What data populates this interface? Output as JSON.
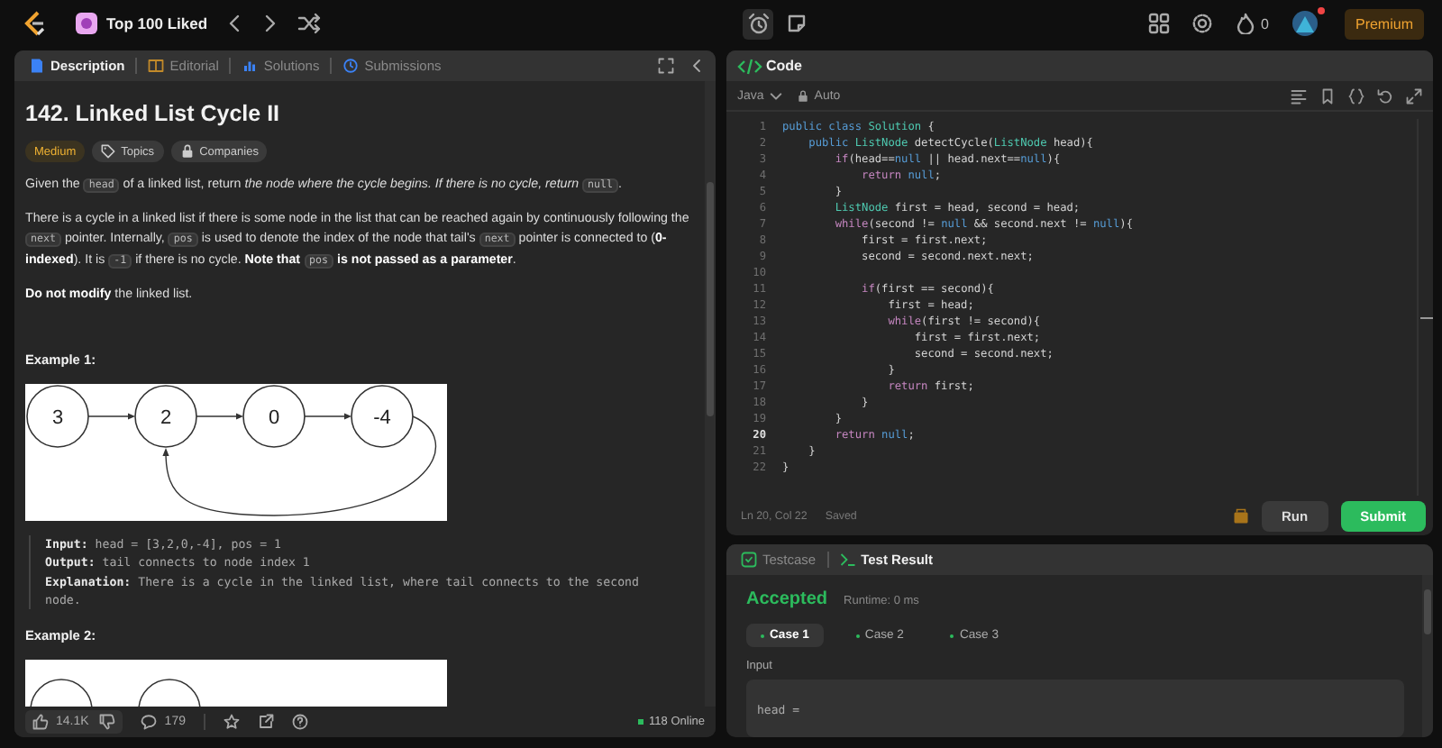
{
  "top_bar": {
    "list_title": "Top 100 Liked",
    "fire_count": "0",
    "premium": "Premium",
    "notification": true
  },
  "description_panel": {
    "tabs": [
      {
        "label": "Description",
        "selected": true
      },
      {
        "label": "Editorial",
        "selected": false
      },
      {
        "label": "Solutions",
        "selected": false
      },
      {
        "label": "Submissions",
        "selected": false
      }
    ],
    "title": "142. Linked List Cycle II",
    "tags": [
      {
        "label": "Medium",
        "kind": "difficulty"
      },
      {
        "label": "Topics",
        "kind": "topics"
      },
      {
        "label": "Companies",
        "kind": "companies"
      }
    ],
    "paragraphs": [
      [
        {
          "kind": "text",
          "text": "Given the "
        },
        {
          "kind": "code",
          "text": "head"
        },
        {
          "kind": "text",
          "text": " of a linked list, return *the node where the cycle begins. If there is no cycle, return* "
        },
        {
          "kind": "code",
          "text": "null"
        },
        {
          "kind": "text",
          "text": "."
        }
      ],
      [
        {
          "kind": "text",
          "text": "There is a cycle in a linked list if there is some node in the list that can be reached again by continuously following the "
        },
        {
          "kind": "code",
          "text": "next"
        },
        {
          "kind": "text",
          "text": " pointer. Internally, "
        },
        {
          "kind": "code",
          "text": "pos"
        },
        {
          "kind": "text",
          "text": " is used to denote the index of the node that tail's "
        },
        {
          "kind": "code",
          "text": "next"
        },
        {
          "kind": "text",
          "text": " pointer is connected to (**0-indexed**). It is "
        },
        {
          "kind": "code",
          "text": "-1"
        },
        {
          "kind": "text",
          "text": " if there is no cycle. **Note that** "
        },
        {
          "kind": "code",
          "text": "pos"
        },
        {
          "kind": "text",
          "text": " **is not passed as a parameter**."
        }
      ],
      [
        {
          "kind": "text",
          "text": "**Do not modify** the linked list."
        }
      ]
    ],
    "examples": [
      {
        "heading": "Example 1:",
        "nodes": [
          "3",
          "2",
          "0",
          "-4"
        ],
        "lines": [
          "**Input:** head = [3,2,0,-4], pos = 1",
          "**Output:** tail connects to node index 1",
          "**Explanation:** There is a cycle in the linked list, where tail connects to the second node."
        ]
      },
      {
        "heading": "Example 2:"
      }
    ],
    "footer": {
      "likes": "14.1K",
      "comments": "179",
      "online": "118 Online"
    }
  },
  "code_panel": {
    "title": "Code",
    "language": "Java",
    "mode": "Auto",
    "lines": [
      {
        "number": "1",
        "tokens": [
          {
            "text": "public class ",
            "kind": "kw"
          },
          {
            "text": "Solution",
            "kind": "ty"
          },
          {
            "text": " {",
            "kind": "p"
          }
        ]
      },
      {
        "number": "2",
        "tokens": [
          {
            "text": "    public ",
            "kind": "kw"
          },
          {
            "text": "ListNode",
            "kind": "ty"
          },
          {
            "text": " detectCycle(",
            "kind": "p"
          },
          {
            "text": "ListNode",
            "kind": "ty"
          },
          {
            "text": " head){",
            "kind": "p"
          }
        ]
      },
      {
        "number": "3",
        "tokens": [
          {
            "text": "        if",
            "kind": "ct"
          },
          {
            "text": "(head==",
            "kind": "p"
          },
          {
            "text": "null",
            "kind": "kw"
          },
          {
            "text": " || head.next==",
            "kind": "p"
          },
          {
            "text": "null",
            "kind": "kw"
          },
          {
            "text": "){",
            "kind": "p"
          }
        ]
      },
      {
        "number": "4",
        "tokens": [
          {
            "text": "            return ",
            "kind": "ct"
          },
          {
            "text": "null",
            "kind": "kw"
          },
          {
            "text": ";",
            "kind": "p"
          }
        ]
      },
      {
        "number": "5",
        "tokens": [
          {
            "text": "        }",
            "kind": "p"
          }
        ]
      },
      {
        "number": "6",
        "tokens": [
          {
            "text": "        ListNode",
            "kind": "ty"
          },
          {
            "text": " first = head, second = head;",
            "kind": "p"
          }
        ]
      },
      {
        "number": "7",
        "tokens": [
          {
            "text": "        while",
            "kind": "ct"
          },
          {
            "text": "(second != ",
            "kind": "p"
          },
          {
            "text": "null",
            "kind": "kw"
          },
          {
            "text": " && second.next != ",
            "kind": "p"
          },
          {
            "text": "null",
            "kind": "kw"
          },
          {
            "text": "){",
            "kind": "p"
          }
        ]
      },
      {
        "number": "8",
        "tokens": [
          {
            "text": "            first = first.next;",
            "kind": "p"
          }
        ]
      },
      {
        "number": "9",
        "tokens": [
          {
            "text": "            second = second.next.next;",
            "kind": "p"
          }
        ]
      },
      {
        "number": "10"
      },
      {
        "number": "11",
        "tokens": [
          {
            "text": "            if",
            "kind": "ct"
          },
          {
            "text": "(first == second){",
            "kind": "p"
          }
        ]
      },
      {
        "number": "12",
        "tokens": [
          {
            "text": "                first = head;",
            "kind": "p"
          }
        ]
      },
      {
        "number": "13",
        "tokens": [
          {
            "text": "                while",
            "kind": "ct"
          },
          {
            "text": "(first != second){",
            "kind": "p"
          }
        ]
      },
      {
        "number": "14",
        "tokens": [
          {
            "text": "                    first = first.next;",
            "kind": "p"
          }
        ]
      },
      {
        "number": "15",
        "tokens": [
          {
            "text": "                    second = second.next;",
            "kind": "p"
          }
        ]
      },
      {
        "number": "16",
        "tokens": [
          {
            "text": "                }",
            "kind": "p"
          }
        ]
      },
      {
        "number": "17",
        "tokens": [
          {
            "text": "                return",
            "kind": "ct"
          },
          {
            "text": " first;",
            "kind": "p"
          }
        ]
      },
      {
        "number": "18",
        "tokens": [
          {
            "text": "            }",
            "kind": "p"
          }
        ]
      },
      {
        "number": "19",
        "tokens": [
          {
            "text": "        }",
            "kind": "p"
          }
        ]
      },
      {
        "number": "20",
        "current": true,
        "tokens": [
          {
            "text": "        return ",
            "kind": "ct"
          },
          {
            "text": "null",
            "kind": "kw"
          },
          {
            "text": ";",
            "kind": "p"
          }
        ]
      },
      {
        "number": "21",
        "tokens": [
          {
            "text": "    }",
            "kind": "p"
          }
        ]
      },
      {
        "number": "22",
        "tokens": [
          {
            "text": "}",
            "kind": "p"
          }
        ]
      }
    ],
    "cursor": "Ln 20, Col 22",
    "save_state": "Saved",
    "buttons": [
      {
        "label": "Run",
        "kind": "run"
      },
      {
        "label": "Submit",
        "kind": "submit"
      }
    ]
  },
  "result_panel": {
    "tabs": [
      {
        "label": "Testcase",
        "selected": false
      },
      {
        "label": "Test Result",
        "selected": true
      }
    ],
    "verdict": "Accepted",
    "runtime": "Runtime: 0 ms",
    "cases": [
      {
        "label": "Case 1",
        "selected": true,
        "passed": true
      },
      {
        "label": "Case 2",
        "selected": false,
        "passed": true
      },
      {
        "label": "Case 3",
        "selected": false,
        "passed": true
      }
    ],
    "input_label": "Input",
    "input_value": "head ="
  }
}
